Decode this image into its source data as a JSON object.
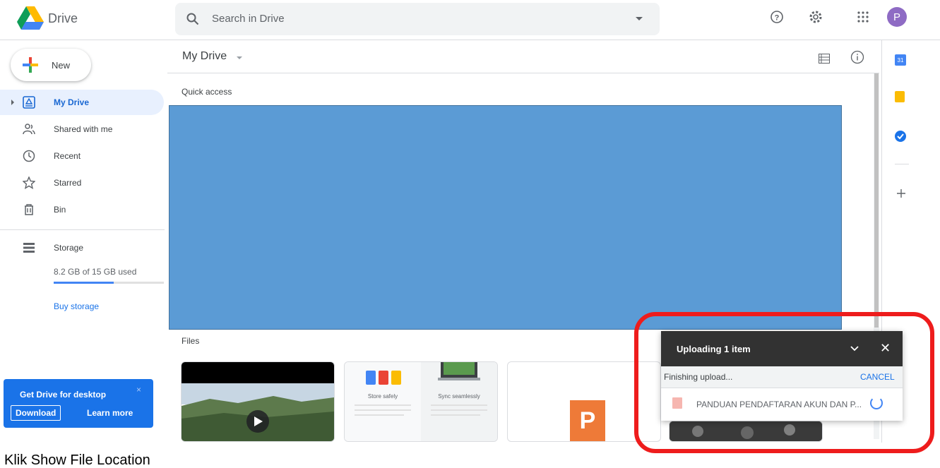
{
  "header": {
    "app_name": "Drive",
    "search_placeholder": "Search in Drive",
    "avatar_letter": "P"
  },
  "sidebar": {
    "new_label": "New",
    "items": [
      {
        "label": "My Drive",
        "icon": "my-drive-icon",
        "active": true
      },
      {
        "label": "Shared with me",
        "icon": "shared-icon"
      },
      {
        "label": "Recent",
        "icon": "clock-icon"
      },
      {
        "label": "Starred",
        "icon": "star-icon"
      },
      {
        "label": "Bin",
        "icon": "bin-icon"
      },
      {
        "label": "Storage",
        "icon": "storage-icon"
      }
    ],
    "storage_text": "8.2 GB of 15 GB used",
    "storage_fraction": 0.547,
    "buy_storage": "Buy storage"
  },
  "promo": {
    "title": "Get Drive for desktop",
    "close": "×",
    "download": "Download",
    "learn_more": "Learn more"
  },
  "main": {
    "title": "My Drive",
    "quick_access": "Quick access",
    "files_label": "Files"
  },
  "cards": {
    "store_safely": "Store safely",
    "sync_seamlessly": "Sync seamlessly",
    "slides_letter": "P"
  },
  "upload": {
    "title": "Uploading 1 item",
    "status": "Finishing upload...",
    "cancel": "CANCEL",
    "file_name": "PANDUAN PENDAFTARAN AKUN DAN P...",
    "close": "✕"
  },
  "caption": "Klik Show File Location",
  "colors": {
    "accent": "#1a73e8",
    "highlight": "#ee1c1c",
    "quick_access_fill": "#5b9bd5"
  }
}
